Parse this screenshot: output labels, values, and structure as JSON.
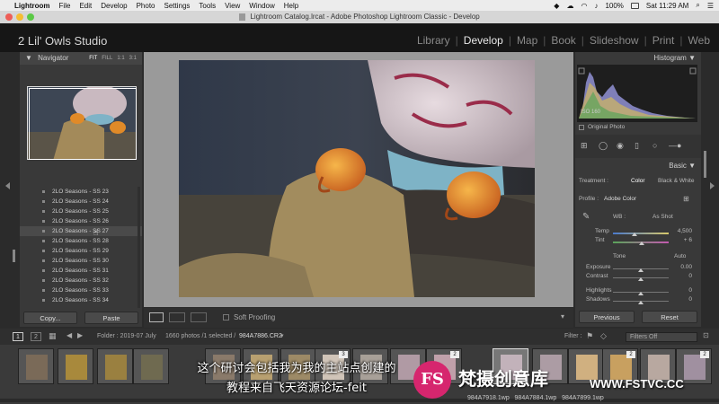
{
  "menubar": {
    "app": "Lightroom",
    "menus": [
      "File",
      "Edit",
      "Develop",
      "Photo",
      "Settings",
      "Tools",
      "View",
      "Window",
      "Help"
    ],
    "battery": "100%",
    "clock": "Sat 11:29 AM"
  },
  "window": {
    "title": "Lightroom Catalog.lrcat - Adobe Photoshop Lightroom Classic - Develop"
  },
  "identity": {
    "studio": "2 Lil' Owls Studio",
    "modules": [
      "Library",
      "Develop",
      "Map",
      "Book",
      "Slideshow",
      "Print",
      "Web"
    ],
    "active_module": "Develop"
  },
  "left_panel": {
    "navigator_label": "Navigator",
    "zoom_options": [
      "FIT",
      "FILL",
      "1:1",
      "3:1"
    ],
    "presets": [
      "2LO Seasons - SS 23",
      "2LO Seasons - SS 24",
      "2LO Seasons - SS 25",
      "2LO Seasons - SS 26",
      "2LO Seasons - SS 27",
      "2LO Seasons - SS 28",
      "2LO Seasons - SS 29",
      "2LO Seasons - SS 30",
      "2LO Seasons - SS 31",
      "2LO Seasons - SS 32",
      "2LO Seasons - SS 33",
      "2LO Seasons - SS 34"
    ],
    "copy_label": "Copy...",
    "paste_label": "Paste"
  },
  "toolbar": {
    "soft_proofing": "Soft Proofing"
  },
  "right_panel": {
    "histogram_label": "Histogram",
    "iso": "ISO 160",
    "original_photo": "Original Photo",
    "basic_label": "Basic",
    "treatment_label": "Treatment :",
    "treatment_color": "Color",
    "treatment_bw": "Black & White",
    "profile_label": "Profile :",
    "profile_value": "Adobe Color",
    "wb_label": "WB :",
    "wb_value": "As Shot",
    "temp_label": "Temp",
    "temp_value": "4,500",
    "tint_label": "Tint",
    "tint_value": "+ 6",
    "tone_label": "Tone",
    "auto_label": "Auto",
    "sliders": [
      {
        "label": "Exposure",
        "value": "0.00",
        "level": 0.5
      },
      {
        "label": "Contrast",
        "value": "0",
        "level": 0.5
      },
      {
        "label": "Highlights",
        "value": "0",
        "level": 0.5
      },
      {
        "label": "Shadows",
        "value": "0",
        "level": 0.5
      }
    ],
    "temp_level": 0.38,
    "tint_level": 0.52,
    "previous_label": "Previous",
    "reset_label": "Reset"
  },
  "filmbar": {
    "view1": "1",
    "view2": "2",
    "folder": "Folder : 2019-07 July",
    "count": "1660 photos /1 selected /",
    "filename": "984A7886.CR2",
    "filter_label": "Filter :",
    "filters_value": "Filters Off"
  },
  "filmstrip_badges": [
    "3",
    "2",
    "2",
    "2"
  ],
  "subtitle": {
    "line1": "这个研讨会包括我为我的主站点创建的",
    "line2": "教程来自飞天资源论坛-feit"
  },
  "watermark": {
    "logo_letters": "FS",
    "brand": "梵摄创意库",
    "site": "WWW.FSTVC.CC",
    "partial_filenames": "984A7918.1wp   984A7884.1wp   984A7899.1wp"
  },
  "colors": {
    "accent_orange": "#e08a28",
    "panel_bg": "#393939",
    "canvas_bg": "#9a9a9a"
  }
}
